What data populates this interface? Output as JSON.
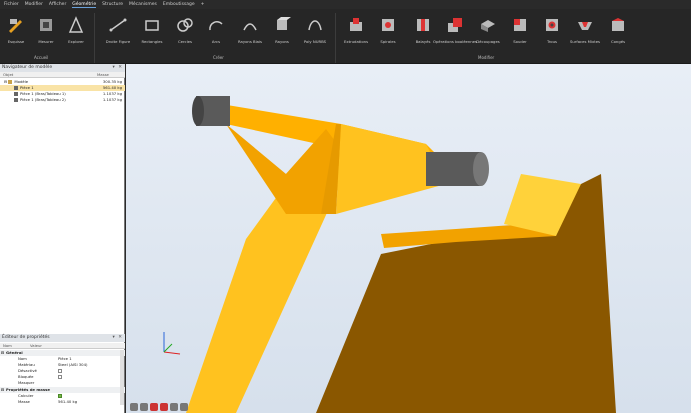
{
  "menu": [
    "Fichier",
    "Modifier",
    "Afficher",
    "Géométrie",
    "Structure",
    "Mécanismes",
    "Emboutissage",
    "+"
  ],
  "menu_active_index": 3,
  "ribbon": {
    "buttons": [
      {
        "label": "Esquisse",
        "icon": "sketch-icon"
      },
      {
        "label": "Mesurer",
        "icon": "measure-icon"
      },
      {
        "label": "Explorer",
        "icon": "explore-icon"
      },
      {
        "label": "Droite Figure",
        "icon": "line-icon"
      },
      {
        "label": "Rectangles",
        "icon": "rectangle-icon"
      },
      {
        "label": "Cercles",
        "icon": "circle-icon"
      },
      {
        "label": "Arcs",
        "icon": "arc-icon"
      },
      {
        "label": "Rayons Biais",
        "icon": "ray-icon"
      },
      {
        "label": "Rayons",
        "icon": "box-icon"
      },
      {
        "label": "Poly NURBS",
        "icon": "nurbs-icon"
      },
      {
        "label": "Extrudations",
        "icon": "extrude-icon"
      },
      {
        "label": "Spirales",
        "icon": "spiral-icon"
      },
      {
        "label": "Balayés",
        "icon": "sweep-icon"
      },
      {
        "label": "Opérations booléennes",
        "icon": "boolean-icon"
      },
      {
        "label": "Découpages",
        "icon": "cut-icon"
      },
      {
        "label": "Souder",
        "icon": "weld-icon"
      },
      {
        "label": "Trous",
        "icon": "hole-icon"
      },
      {
        "label": "Surfaces Mixtes",
        "icon": "blend-icon"
      },
      {
        "label": "Congés",
        "icon": "fillet-icon"
      }
    ],
    "groups": {
      "accueil": "Accueil",
      "creer": "Créer",
      "modifier": "Modifier"
    }
  },
  "model_nav": {
    "title": "Navigateur de modèle",
    "col_object": "Objet",
    "col_mass": "Masse",
    "rows": [
      {
        "label": "Modèle",
        "value": "300.35 kg",
        "selected": false
      },
      {
        "label": "Pièce 1",
        "value": "561.40 kg",
        "selected": true
      },
      {
        "label": "Pièce 1 (Bras/Tableau 1)",
        "value": "1.1037 kg",
        "selected": false
      },
      {
        "label": "Pièce 1 (Bras/Tableau 2)",
        "value": "1.1037 kg",
        "selected": false
      }
    ]
  },
  "properties": {
    "title": "Éditeur de propriétés",
    "col_name": "Nom",
    "col_value": "Valeur",
    "general": "Général",
    "rows": [
      {
        "k": "Nom",
        "v": "Pièce 1"
      },
      {
        "k": "Matériau",
        "v": "Steel (AISI 304)"
      },
      {
        "k": "Désactivé",
        "v": ""
      },
      {
        "k": "Bloquée",
        "v": ""
      },
      {
        "k": "Masquer",
        "v": ""
      }
    ],
    "mass_props": "Propriétés de masse",
    "calc_label": "Calculer",
    "mass_label": "Masse",
    "mass_value": "561.40 kg"
  },
  "colors": {
    "accent": "#6aa0d8",
    "part_light": "#ffc21f",
    "part_mid": "#f2a200",
    "part_dark": "#8a5700",
    "pipe": "#555555"
  }
}
